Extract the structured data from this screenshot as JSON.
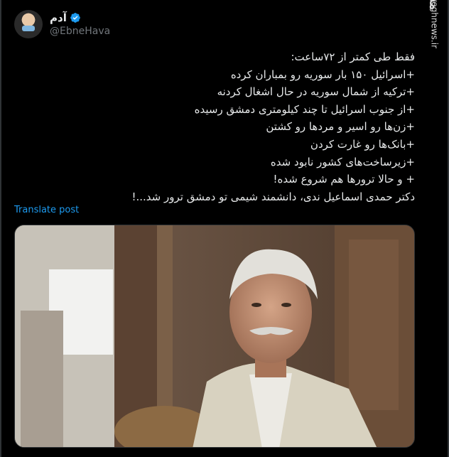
{
  "account": {
    "display_name": "آدم",
    "handle": "@EbneHava",
    "verified": true,
    "avatar_icon": "child-with-mask-avatar"
  },
  "watermark": {
    "logo_text": "مشرق",
    "site": "mashreghnews.ir"
  },
  "tweet": {
    "lines": [
      "فقط طی کمتر از ۷۲ساعت:",
      "+اسرائیل ۱۵۰ بار سوریه رو بمباران کرده",
      "+ترکیه از شمال سوریه در حال اشغال کردنه",
      "+از جنوب اسرائیل تا چند کیلومتری دمشق رسیده",
      "+زن‌ها رو اسیر و مردها رو کشتن",
      "+بانک‌ها رو غارت کردن",
      "+زیرساخت‌های کشور نابود شده",
      "+ و حالا ترورها هم شروع شده!",
      "دکتر حمدی اسماعیل ندی، دانشمند شیمی تو دمشق ترور شد...!"
    ],
    "translate_label": "Translate post"
  },
  "media": {
    "description_icon": "portrait-photo",
    "colors": {
      "jacket": "#d8d2c0",
      "wall": "#6d5a4a",
      "window": "#f2f2f0"
    }
  },
  "colors": {
    "background": "#000000",
    "text": "#e7e9ea",
    "muted": "#71767b",
    "accent": "#1d9bf0",
    "border": "#2f3336"
  }
}
